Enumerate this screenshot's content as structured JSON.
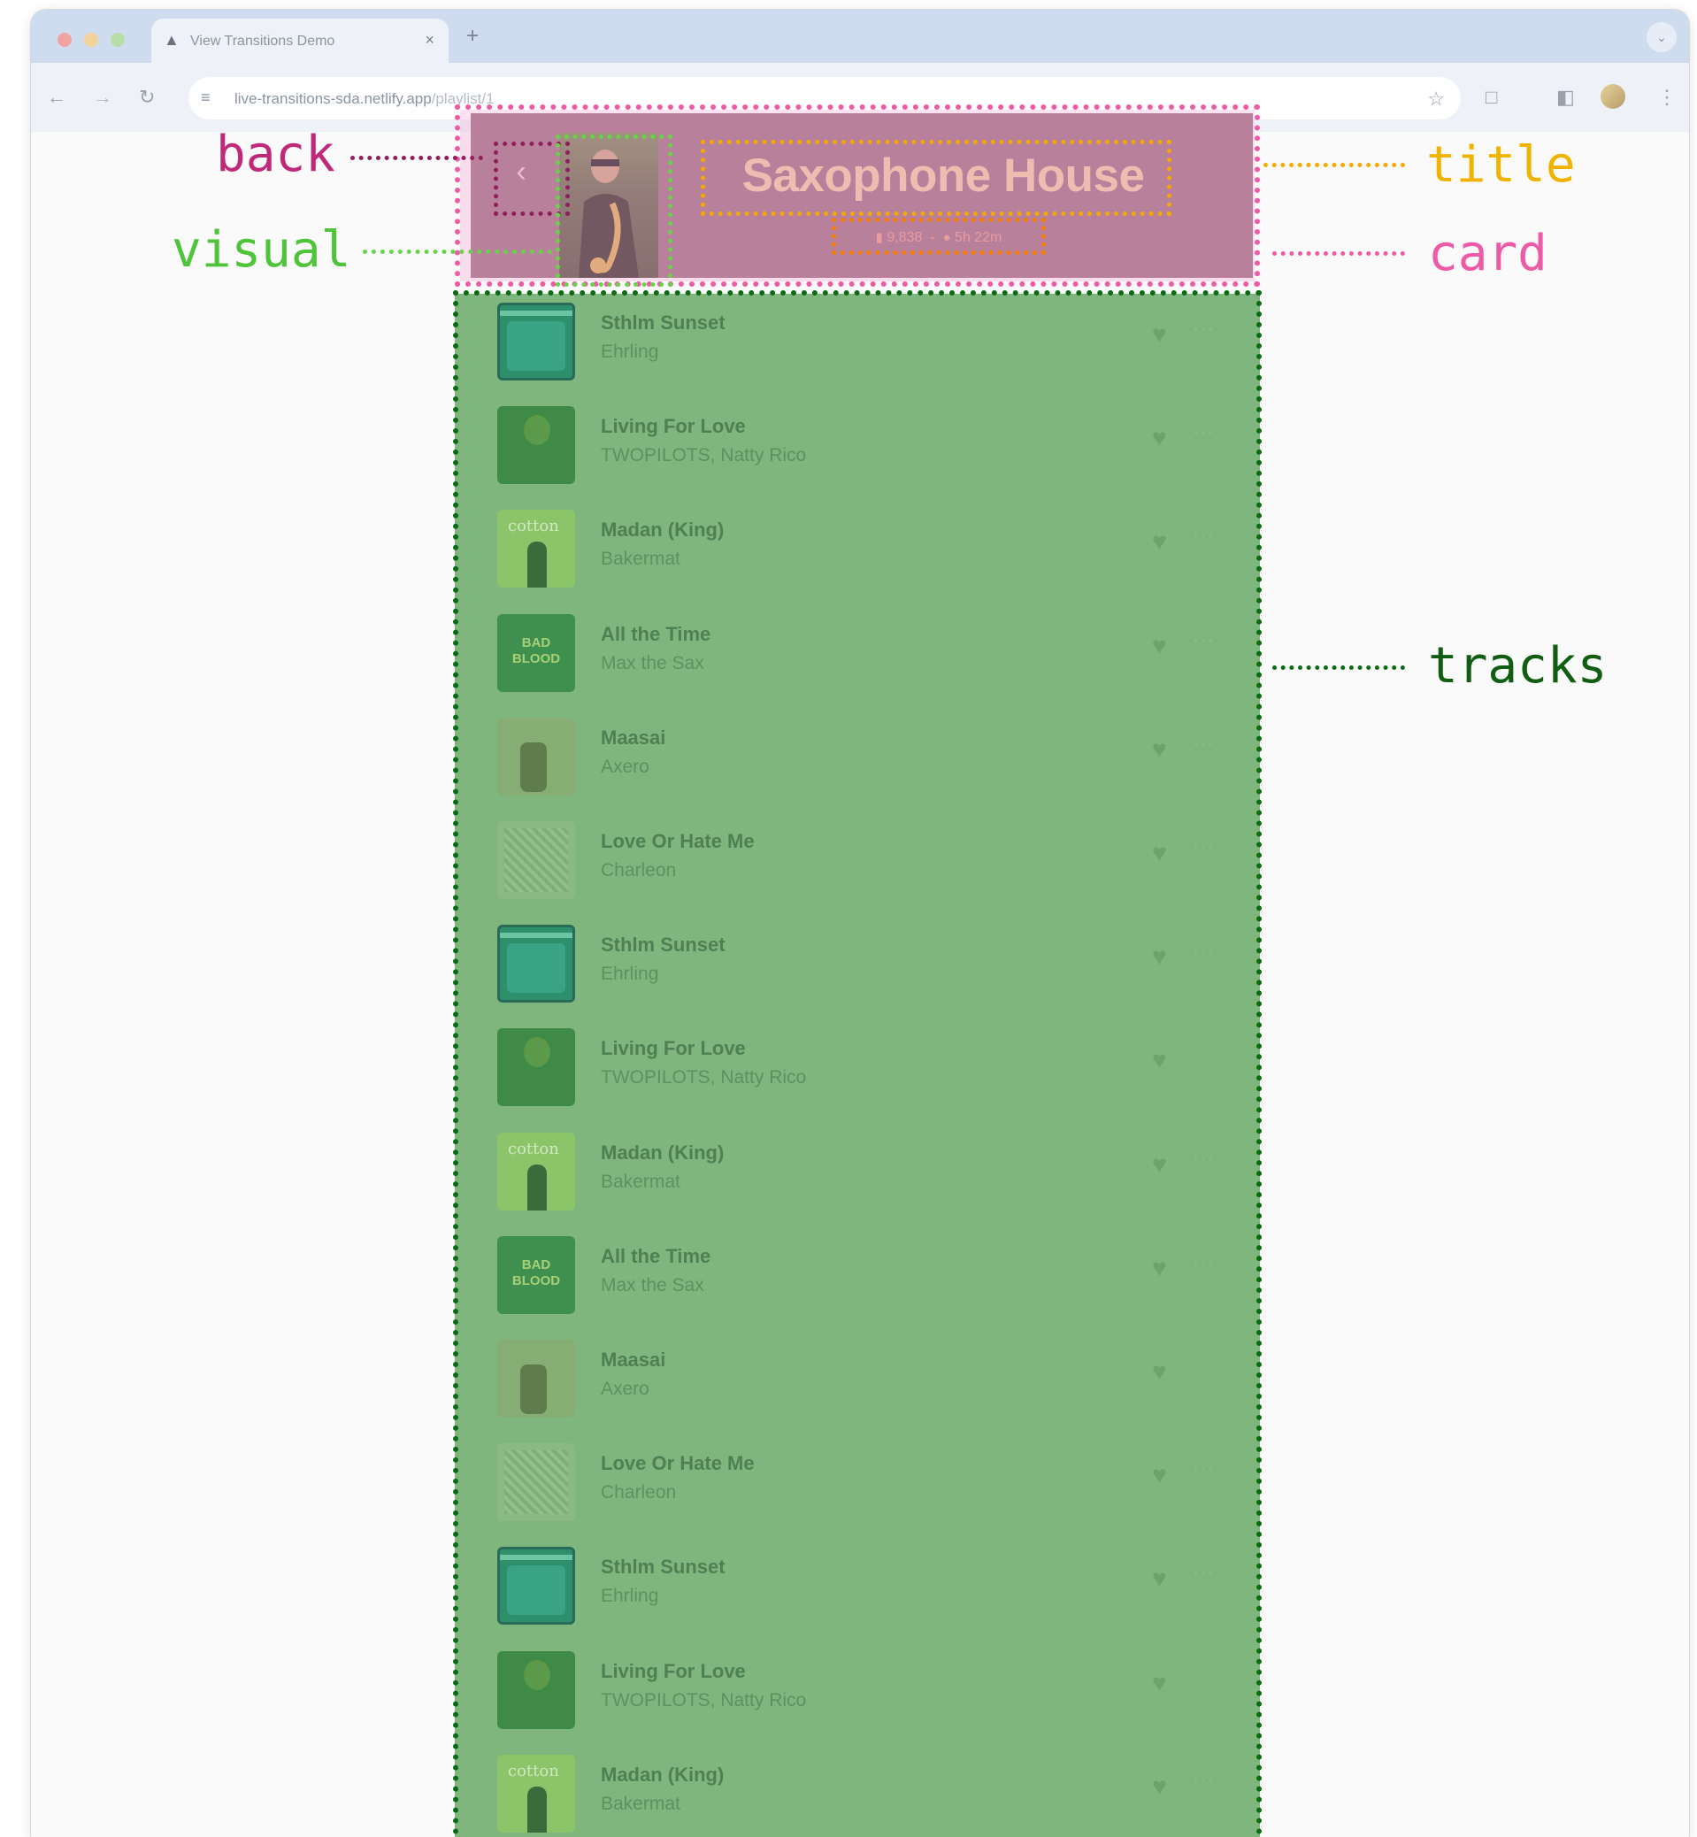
{
  "browser": {
    "tab_title": "View Transitions Demo",
    "tab_close": "×",
    "new_tab": "+",
    "url_host": "live-transitions-sda.netlify.app",
    "url_path": "/playlist/1"
  },
  "playlist": {
    "title": "Saxophone House",
    "plays": "9,838",
    "separator": "-",
    "duration": "5h 22m"
  },
  "tracks": [
    {
      "name": "Sthlm Sunset",
      "artist": "Ehrling",
      "art": "sthlm"
    },
    {
      "name": "Living For Love",
      "artist": "TWOPILOTS, Natty Rico",
      "art": "living"
    },
    {
      "name": "Madan (King)",
      "artist": "Bakermat",
      "art": "madan"
    },
    {
      "name": "All the Time",
      "artist": "Max the Sax",
      "art": "alltime"
    },
    {
      "name": "Maasai",
      "artist": "Axero",
      "art": "maasai"
    },
    {
      "name": "Love Or Hate Me",
      "artist": "Charleon",
      "art": "love"
    },
    {
      "name": "Sthlm Sunset",
      "artist": "Ehrling",
      "art": "sthlm"
    },
    {
      "name": "Living For Love",
      "artist": "TWOPILOTS, Natty Rico",
      "art": "living"
    },
    {
      "name": "Madan (King)",
      "artist": "Bakermat",
      "art": "madan"
    },
    {
      "name": "All the Time",
      "artist": "Max the Sax",
      "art": "alltime"
    },
    {
      "name": "Maasai",
      "artist": "Axero",
      "art": "maasai"
    },
    {
      "name": "Love Or Hate Me",
      "artist": "Charleon",
      "art": "love"
    },
    {
      "name": "Sthlm Sunset",
      "artist": "Ehrling",
      "art": "sthlm"
    },
    {
      "name": "Living For Love",
      "artist": "TWOPILOTS, Natty Rico",
      "art": "living"
    },
    {
      "name": "Madan (King)",
      "artist": "Bakermat",
      "art": "madan"
    }
  ],
  "annotations": {
    "back": "back",
    "visual": "visual",
    "title": "title",
    "card": "card",
    "tracks": "tracks"
  },
  "colors": {
    "card": "#9e7384",
    "tracks": "#7fb67d",
    "label_back": "#c0297a",
    "label_visual": "#4fc43a",
    "label_title": "#f0b400",
    "label_card": "#ee5aa6",
    "label_tracks": "#115e13"
  }
}
